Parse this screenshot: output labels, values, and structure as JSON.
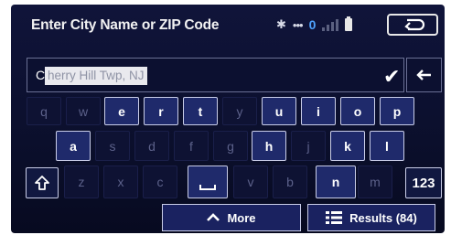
{
  "titlebar": {
    "title": "Enter City Name or ZIP Code",
    "status_bt": "✱",
    "status_dots": "•••",
    "status_count": "0",
    "icons": [
      "bluetooth-icon",
      "signal-icon",
      "battery-icon",
      "back-icon"
    ]
  },
  "input": {
    "first_char": "C",
    "rest_text": "herry Hill Twp, NJ",
    "confirm_icon": "checkmark-icon",
    "backspace_icon": "backspace-arrow-icon"
  },
  "keyboard": {
    "row1": [
      {
        "label": "q",
        "active": false
      },
      {
        "label": "w",
        "active": false
      },
      {
        "label": "e",
        "active": true
      },
      {
        "label": "r",
        "active": true
      },
      {
        "label": "t",
        "active": true
      },
      {
        "label": "y",
        "active": false
      },
      {
        "label": "u",
        "active": true
      },
      {
        "label": "i",
        "active": true
      },
      {
        "label": "o",
        "active": true
      },
      {
        "label": "p",
        "active": true
      }
    ],
    "row2": [
      {
        "label": "a",
        "active": true
      },
      {
        "label": "s",
        "active": false
      },
      {
        "label": "d",
        "active": false
      },
      {
        "label": "f",
        "active": false
      },
      {
        "label": "g",
        "active": false
      },
      {
        "label": "h",
        "active": true
      },
      {
        "label": "j",
        "active": false
      },
      {
        "label": "k",
        "active": true
      },
      {
        "label": "l",
        "active": true
      }
    ],
    "row3": [
      {
        "label": "z",
        "active": false
      },
      {
        "label": "x",
        "active": false
      },
      {
        "label": "c",
        "active": false
      },
      {
        "label": "space",
        "active": true
      },
      {
        "label": "v",
        "active": false
      },
      {
        "label": "b",
        "active": false
      },
      {
        "label": "n",
        "active": true
      },
      {
        "label": "m",
        "active": false
      }
    ],
    "shift_icon": "shift-arrow-icon",
    "num_label": "123"
  },
  "bottom": {
    "more_label": "More",
    "more_icon": "chevron-up-icon",
    "results_label": "Results (84)",
    "results_icon": "list-icon"
  },
  "colors": {
    "background": "#0b0f2c",
    "key_active": "#1f2a6b",
    "key_dim_text": "#5c618a",
    "accent_blue": "#4fa3ff"
  }
}
